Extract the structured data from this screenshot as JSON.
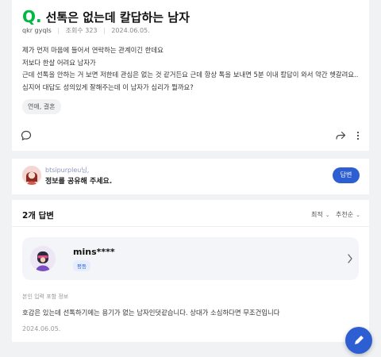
{
  "question": {
    "mark": "Q.",
    "title": "선톡은 없는데 칼답하는 남자",
    "author": "qkr gyqls",
    "views_label": "조회수 323",
    "date": "2024.06.05.",
    "body_lines": [
      "제가 먼저 마음에 들어서 연락하는 관계이긴 한데요",
      "저보다 한살 어려요 남자가",
      "근데 선톡을 안하는 거 보면 저한테 관심은 없는 것 같거든요 근데 항상 톡을 보내면 5분 이내 칼답이 와서 약간 헷갈려요..",
      "심지어 대답도 성의있게 잘해주는데 이 남자가 심리가 뭘까요?"
    ],
    "tag": "연애, 결혼",
    "icons": [
      "comment-icon",
      "share-icon",
      "more-icon"
    ]
  },
  "cta": {
    "user": "btsipurpleu님,",
    "message": "정보를 공유해 주세요.",
    "button_label": "답변"
  },
  "answers": {
    "count_label": "2개 답변",
    "sort_latest": "최적",
    "sort_recommend": "추천순",
    "profile_name": "mins****",
    "grade": "평등",
    "source_note": "본인 입력 포함 정보",
    "text": "호감은 있는데 선톡하기에는 용기가 없는 남자인덧같습니다. 상대가 소심하다면 무조건입니다",
    "date": "2024.06.05."
  },
  "colors": {
    "q_mark": "#00b843",
    "primary": "#2d5fd3",
    "background": "#f1f2f4"
  }
}
